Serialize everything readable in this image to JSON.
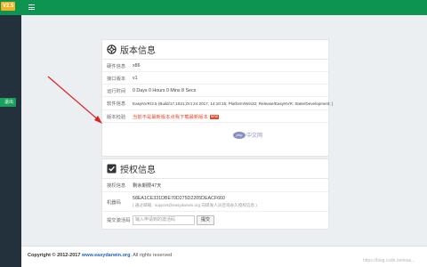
{
  "topbar": {
    "version": "V2.5"
  },
  "sidebar": {
    "logout_label": "退出"
  },
  "version_panel": {
    "title": "版本信息",
    "rows": [
      {
        "label": "硬件信息",
        "value": "x86"
      },
      {
        "label": "接口版本",
        "value": "v1"
      },
      {
        "label": "运行时间",
        "value": "0 Days 0 Hours 0 Mins 8 Secs"
      },
      {
        "label": "软件信息",
        "value": "EasyNVR/2.5 (Build/17.1021;Oct 24 2017, 14:10:15; Platform/Win32; Release/EasyNVR; State/Development; )"
      },
      {
        "label": "版本检验",
        "value": "当前不是最新版本点我下载最新版本",
        "badge": "NEW"
      }
    ]
  },
  "license_panel": {
    "title": "授权信息",
    "rows": [
      {
        "label": "授权信息",
        "value": "剩余期限47天"
      },
      {
        "label": "机器码",
        "value": "58EA1CE331DBE70D275D2205DEACF660",
        "note": "( 通过邮箱 : support@easydarwin.org 向研发人员咨询永久授权信息 )"
      },
      {
        "label": "提交激活码",
        "placeholder": "输入申请到的激活码",
        "button": "提交"
      }
    ]
  },
  "footer": {
    "prefix": "Copyright © 2012-2017 ",
    "brand": "www.easydarwin.org",
    "suffix": ". All rights reserved"
  },
  "watermark": {
    "logo": "php",
    "text": "中文网"
  },
  "url_watermark": "https://blog.csdn.net/eas..."
}
